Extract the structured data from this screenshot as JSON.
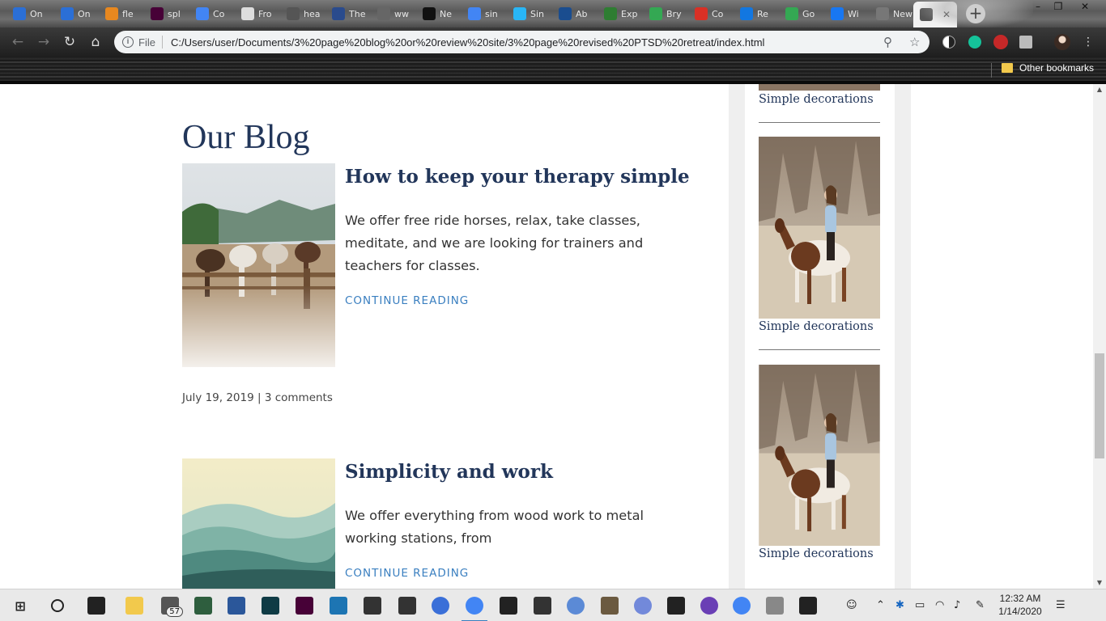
{
  "browser": {
    "tabs": [
      {
        "label": "On",
        "icon": "map-pin-icon",
        "color": "#2b6fd6"
      },
      {
        "label": "On",
        "icon": "map-pin-icon",
        "color": "#2b6fd6"
      },
      {
        "label": "fle",
        "icon": "chart-icon",
        "color": "#e8881f"
      },
      {
        "label": "spl",
        "icon": "adobe-xd-icon",
        "color": "#470137"
      },
      {
        "label": "Co",
        "icon": "docs-icon",
        "color": "#4285f4"
      },
      {
        "label": "Fro",
        "icon": "page-icon",
        "color": "#dddddd"
      },
      {
        "label": "hea",
        "icon": "globe-icon",
        "color": "#555555"
      },
      {
        "label": "The",
        "icon": "chart-line-icon",
        "color": "#2a4b8d"
      },
      {
        "label": "ww",
        "icon": "blank-icon",
        "color": "#666666"
      },
      {
        "label": "Ne",
        "icon": "rr-icon",
        "color": "#111111"
      },
      {
        "label": "sin",
        "icon": "google-icon",
        "color": "#4285f4"
      },
      {
        "label": "Sin",
        "icon": "infinity-icon",
        "color": "#29b6f6"
      },
      {
        "label": "Ab",
        "icon": "globe-icon",
        "color": "#1a4d8f"
      },
      {
        "label": "Exp",
        "icon": "globe-icon",
        "color": "#2e7d32"
      },
      {
        "label": "Bry",
        "icon": "maps-icon",
        "color": "#34a853"
      },
      {
        "label": "Co",
        "icon": "gmail-icon",
        "color": "#d93025"
      },
      {
        "label": "Re",
        "icon": "zillow-icon",
        "color": "#1277e1"
      },
      {
        "label": "Go",
        "icon": "maps-icon",
        "color": "#34a853"
      },
      {
        "label": "Wi",
        "icon": "facebook-icon",
        "color": "#1877f2"
      },
      {
        "label": "New Ta",
        "icon": "blank-icon",
        "color": "#777777"
      },
      {
        "label": "",
        "icon": "globe-icon",
        "color": "#555555",
        "active": true
      }
    ],
    "new_tab_label": "+",
    "window_controls": {
      "minimize": "–",
      "restore": "❐",
      "close": "✕"
    },
    "address": {
      "scheme": "File",
      "url": "C:/Users/user/Documents/3%20page%20blog%20or%20review%20site/3%20page%20revised%20PTSD%20retreat/index.html"
    },
    "nav": {
      "back": "←",
      "forward": "→",
      "reload": "↻",
      "home": "⌂"
    },
    "bookmarks": {
      "other_label": "Other bookmarks"
    }
  },
  "page": {
    "blog_title": "Our Blog",
    "posts": [
      {
        "title": "How to keep your therapy simple",
        "excerpt": "We offer free ride horses, relax, take classes, meditate, and we are looking for trainers and teachers for classes.",
        "cta": "CONTINUE READING",
        "date": "July 19, 2019",
        "separator": " | ",
        "comments": "3 comments",
        "image": "horses-at-hitching-rail"
      },
      {
        "title": "Simplicity and work",
        "excerpt": "We offer everything from wood work to metal working stations, from",
        "cta": "CONTINUE READING",
        "image": "misty-mountains"
      }
    ],
    "sidebar": {
      "items": [
        {
          "caption": "Simple decorations",
          "image": "woman-on-horse"
        },
        {
          "caption": "Simple decorations",
          "image": "woman-on-horse"
        },
        {
          "caption": "Simple decorations",
          "image": "woman-on-horse"
        }
      ]
    }
  },
  "taskbar": {
    "apps": [
      {
        "icon": "windows-start-icon",
        "color": "#222222"
      },
      {
        "icon": "cortana-icon",
        "color": "#222222"
      },
      {
        "icon": "task-view-icon",
        "color": "#222222"
      },
      {
        "icon": "file-explorer-icon",
        "color": "#f2c94c"
      },
      {
        "icon": "mail-icon",
        "color": "#555555",
        "badge": "57"
      },
      {
        "icon": "app-green-icon",
        "color": "#2e5e3e"
      },
      {
        "icon": "word-icon",
        "color": "#2b579a"
      },
      {
        "icon": "app-teal-icon",
        "color": "#0f3b45"
      },
      {
        "icon": "adobe-xd-icon",
        "color": "#470137"
      },
      {
        "icon": "brackets-icon",
        "color": "#1d75b3"
      },
      {
        "icon": "app-color-icon",
        "color": "#333333"
      },
      {
        "icon": "app-grid-icon",
        "color": "#333333"
      },
      {
        "icon": "firefox-icon",
        "color": "#3a6fd8"
      },
      {
        "icon": "chrome-icon",
        "color": "#4285f4",
        "active": true
      },
      {
        "icon": "inkscape-icon",
        "color": "#222222"
      },
      {
        "icon": "calculator-icon",
        "color": "#333333"
      },
      {
        "icon": "qbittorrent-icon",
        "color": "#5b8ad6"
      },
      {
        "icon": "gimp-icon",
        "color": "#6b5a40"
      },
      {
        "icon": "discord-icon",
        "color": "#7289da"
      },
      {
        "icon": "terminal-icon",
        "color": "#222222"
      },
      {
        "icon": "podcast-icon",
        "color": "#6a3fb5"
      },
      {
        "icon": "chrome-icon",
        "color": "#4285f4"
      },
      {
        "icon": "chart-app-icon",
        "color": "#888888"
      },
      {
        "icon": "photos-icon",
        "color": "#222222"
      }
    ],
    "clock": {
      "time": "12:32 AM",
      "date": "1/14/2020"
    }
  }
}
